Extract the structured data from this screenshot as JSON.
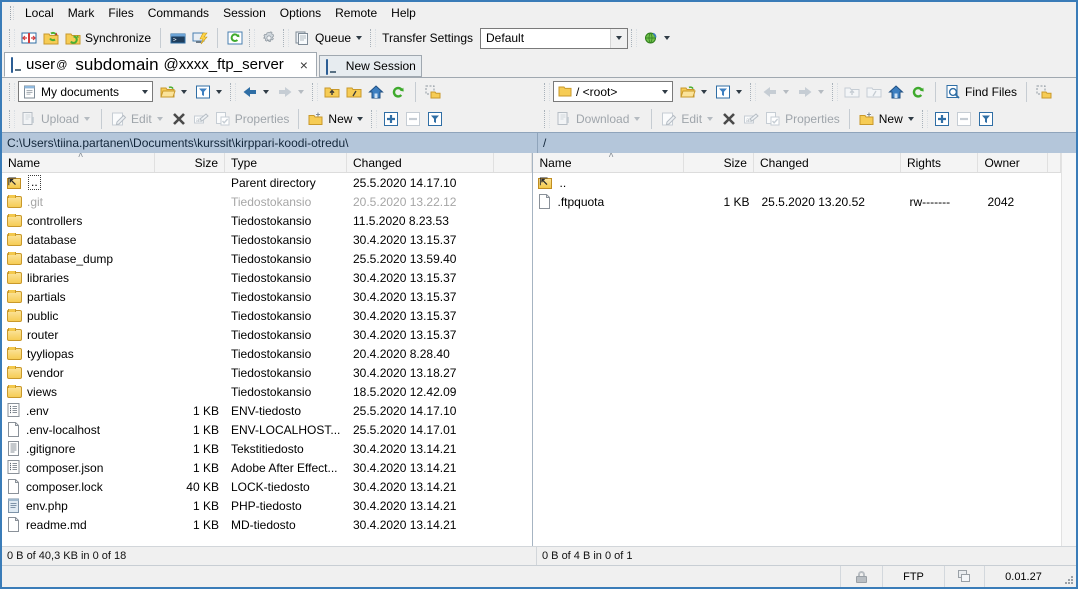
{
  "menu": {
    "items": [
      "Local",
      "Mark",
      "Files",
      "Commands",
      "Session",
      "Options",
      "Remote",
      "Help"
    ]
  },
  "toolbar": {
    "synchronize_label": "Synchronize",
    "queue_label": "Queue",
    "transfer_settings_label": "Transfer Settings",
    "transfer_settings_value": "Default",
    "icons": [
      "split-panels-icon",
      "synchronize-browsing-icon",
      "synchronize-folders-icon",
      "console-icon",
      "putty-icon",
      "refresh-icon",
      "preferences-gear-icon",
      "queue-icon",
      "transfer-globe-icon"
    ]
  },
  "tabs": {
    "session": {
      "user": "user",
      "at1": "@",
      "host": "subdomain",
      "at2_server": "@xxxx_ftp_server",
      "close": "×"
    },
    "new_session": "New Session"
  },
  "local_panel": {
    "location_label": "My documents",
    "buttons": {
      "upload": "Upload",
      "edit": "Edit",
      "properties": "Properties",
      "new": "New"
    },
    "path": "C:\\Users\\tiina.partanen\\Documents\\kurssit\\kirppari-koodi-otredu\\",
    "columns": [
      "Name",
      "Size",
      "Type",
      "Changed"
    ],
    "sort_column": "Name",
    "sort_mark": "˄",
    "rows": [
      {
        "icon": "parent-directory-icon",
        "name": "..",
        "size": "",
        "type": "Parent directory",
        "changed": "25.5.2020  14.17.10",
        "focused": true,
        "dim": false
      },
      {
        "icon": "folder-icon",
        "name": ".git",
        "size": "",
        "type": "Tiedostokansio",
        "changed": "20.5.2020  13.22.12",
        "focused": false,
        "dim": true
      },
      {
        "icon": "folder-icon",
        "name": "controllers",
        "size": "",
        "type": "Tiedostokansio",
        "changed": "11.5.2020  8.23.53",
        "focused": false,
        "dim": false
      },
      {
        "icon": "folder-icon",
        "name": "database",
        "size": "",
        "type": "Tiedostokansio",
        "changed": "30.4.2020  13.15.37",
        "focused": false,
        "dim": false
      },
      {
        "icon": "folder-icon",
        "name": "database_dump",
        "size": "",
        "type": "Tiedostokansio",
        "changed": "25.5.2020  13.59.40",
        "focused": false,
        "dim": false
      },
      {
        "icon": "folder-icon",
        "name": "libraries",
        "size": "",
        "type": "Tiedostokansio",
        "changed": "30.4.2020  13.15.37",
        "focused": false,
        "dim": false
      },
      {
        "icon": "folder-icon",
        "name": "partials",
        "size": "",
        "type": "Tiedostokansio",
        "changed": "30.4.2020  13.15.37",
        "focused": false,
        "dim": false
      },
      {
        "icon": "folder-icon",
        "name": "public",
        "size": "",
        "type": "Tiedostokansio",
        "changed": "30.4.2020  13.15.37",
        "focused": false,
        "dim": false
      },
      {
        "icon": "folder-icon",
        "name": "router",
        "size": "",
        "type": "Tiedostokansio",
        "changed": "30.4.2020  13.15.37",
        "focused": false,
        "dim": false
      },
      {
        "icon": "folder-icon",
        "name": "tyyliopas",
        "size": "",
        "type": "Tiedostokansio",
        "changed": "20.4.2020  8.28.40",
        "focused": false,
        "dim": false
      },
      {
        "icon": "folder-icon",
        "name": "vendor",
        "size": "",
        "type": "Tiedostokansio",
        "changed": "30.4.2020  13.18.27",
        "focused": false,
        "dim": false
      },
      {
        "icon": "folder-icon",
        "name": "views",
        "size": "",
        "type": "Tiedostokansio",
        "changed": "18.5.2020  12.42.09",
        "focused": false,
        "dim": false
      },
      {
        "icon": "env-file-icon",
        "name": ".env",
        "size": "1 KB",
        "type": "ENV-tiedosto",
        "changed": "25.5.2020  14.17.10",
        "focused": false,
        "dim": false
      },
      {
        "icon": "blank-file-icon",
        "name": ".env-localhost",
        "size": "1 KB",
        "type": "ENV-LOCALHOST...",
        "changed": "25.5.2020  14.17.01",
        "focused": false,
        "dim": false
      },
      {
        "icon": "text-file-icon",
        "name": ".gitignore",
        "size": "1 KB",
        "type": "Tekstitiedosto",
        "changed": "30.4.2020  13.14.21",
        "focused": false,
        "dim": false
      },
      {
        "icon": "json-file-icon",
        "name": "composer.json",
        "size": "1 KB",
        "type": "Adobe After Effect...",
        "changed": "30.4.2020  13.14.21",
        "focused": false,
        "dim": false
      },
      {
        "icon": "blank-file-icon",
        "name": "composer.lock",
        "size": "40 KB",
        "type": "LOCK-tiedosto",
        "changed": "30.4.2020  13.14.21",
        "focused": false,
        "dim": false
      },
      {
        "icon": "php-file-icon",
        "name": "env.php",
        "size": "1 KB",
        "type": "PHP-tiedosto",
        "changed": "30.4.2020  13.14.21",
        "focused": false,
        "dim": false
      },
      {
        "icon": "blank-file-icon",
        "name": "readme.md",
        "size": "1 KB",
        "type": "MD-tiedosto",
        "changed": "30.4.2020  13.14.21",
        "focused": false,
        "dim": false
      }
    ],
    "status": "0 B of 40,3 KB in 0 of 18"
  },
  "remote_panel": {
    "location_label": "/ <root>",
    "find_files_label": "Find Files",
    "buttons": {
      "download": "Download",
      "edit": "Edit",
      "properties": "Properties",
      "new": "New"
    },
    "path": "/",
    "columns": [
      "Name",
      "Size",
      "Changed",
      "Rights",
      "Owner"
    ],
    "sort_column": "Name",
    "sort_mark": "˄",
    "rows": [
      {
        "icon": "parent-directory-icon",
        "name": "..",
        "size": "",
        "changed": "",
        "rights": "",
        "owner": ""
      },
      {
        "icon": "blank-file-icon",
        "name": ".ftpquota",
        "size": "1 KB",
        "changed": "25.5.2020 13.20.52",
        "rights": "rw-------",
        "owner": "2042"
      }
    ],
    "status": "0 B of 4 B in 0 of 1"
  },
  "statusbar": {
    "lock_icon": "lock-icon",
    "protocol": "FTP",
    "transfer_icon": "transfer-icon",
    "elapsed": "0.01.27"
  },
  "colors": {
    "window_border": "#3a7cb8",
    "pathbar_bg": "#b4c6da",
    "toolbar_bg": "#f0f0f0",
    "folder_yellow": "#f6cc55"
  }
}
